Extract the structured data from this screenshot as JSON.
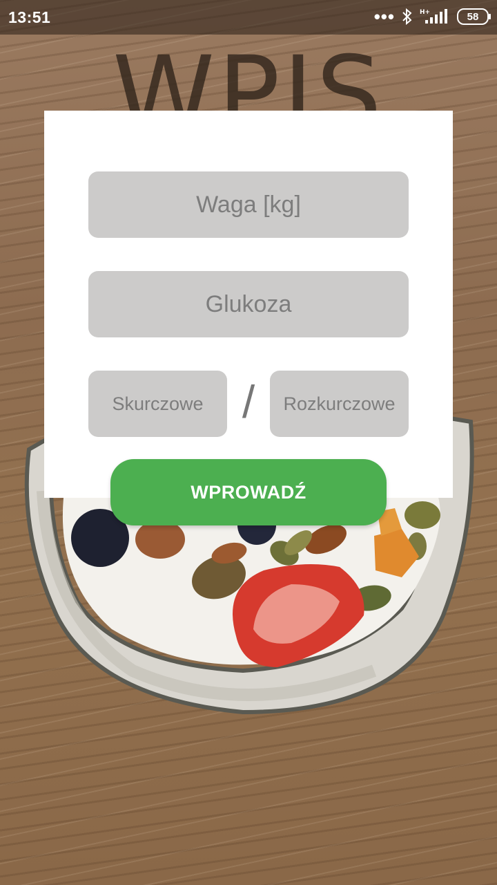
{
  "status_bar": {
    "time": "13:51",
    "battery": "58",
    "network": "H+",
    "icons": [
      "more-dots-icon",
      "bluetooth-icon",
      "signal-icon",
      "battery-icon"
    ]
  },
  "page": {
    "title": "WPIS"
  },
  "form": {
    "weight_placeholder": "Waga [kg]",
    "glucose_placeholder": "Glukoza",
    "systolic_placeholder": "Skurczowe",
    "separator": "/",
    "diastolic_placeholder": "Rozkurczowe",
    "submit_label": "WPROWADŹ"
  },
  "colors": {
    "accent": "#4caf50",
    "field_background": "#cccbca",
    "placeholder_text": "#7d7d7d",
    "card_background": "#ffffff"
  }
}
